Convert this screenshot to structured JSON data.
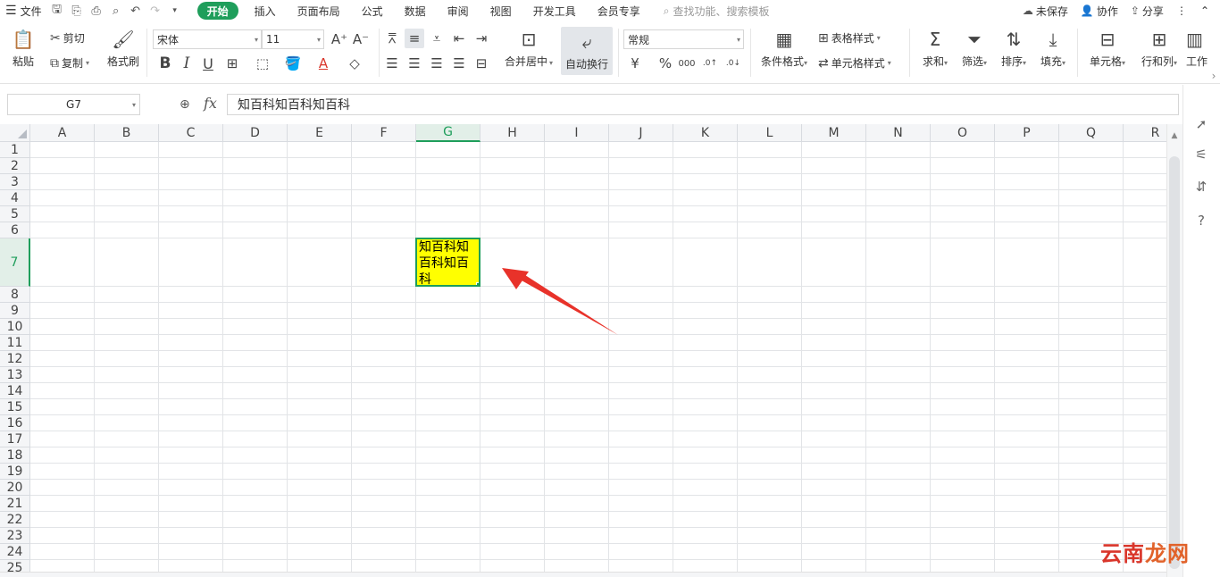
{
  "menubar": {
    "file_label": "文件",
    "tabs": [
      "开始",
      "插入",
      "页面布局",
      "公式",
      "数据",
      "审阅",
      "视图",
      "开发工具",
      "会员专享"
    ],
    "active_tab": "开始",
    "search_placeholder": "查找功能、搜索模板",
    "unsaved_label": "未保存",
    "collab_label": "协作",
    "share_label": "分享"
  },
  "ribbon": {
    "paste_label": "粘贴",
    "cut_label": "剪切",
    "copy_label": "复制",
    "format_painter_label": "格式刷",
    "font_name": "宋体",
    "font_size": "11",
    "merge_label": "合并居中",
    "wrap_label": "自动换行",
    "number_format": "常规",
    "conditional_format_label": "条件格式",
    "table_style_label": "表格样式",
    "cell_style_label": "单元格样式",
    "sum_label": "求和",
    "filter_label": "筛选",
    "sort_label": "排序",
    "fill_label": "填充",
    "cell_label": "单元格",
    "rowcol_label": "行和列",
    "worksheet_label": "工作"
  },
  "formula_bar": {
    "cell_ref": "G7",
    "fx_label": "fx",
    "content": "知百科知百科知百科"
  },
  "sheet": {
    "columns": [
      "A",
      "B",
      "C",
      "D",
      "E",
      "F",
      "G",
      "H",
      "I",
      "J",
      "K",
      "L",
      "M",
      "N",
      "O",
      "P",
      "Q",
      "R"
    ],
    "rows": [
      "1",
      "2",
      "3",
      "4",
      "5",
      "6",
      "7",
      "8",
      "9",
      "10",
      "11",
      "12",
      "13",
      "14",
      "15",
      "16",
      "17",
      "18",
      "19",
      "20",
      "21",
      "22",
      "23",
      "24",
      "25"
    ],
    "selected_column": "G",
    "selected_row": "7",
    "selected_cell_value": "知百科知百科知百科",
    "selected_cell_fill": "#ffff00"
  },
  "colors": {
    "accent": "#1f9e5b",
    "arrow": "#e8322a"
  },
  "watermark": {
    "text_a": "云南",
    "text_b": "龙网"
  }
}
